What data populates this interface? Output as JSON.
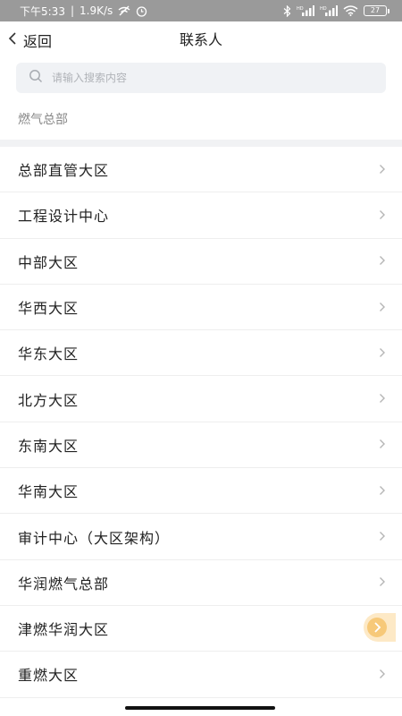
{
  "status_bar": {
    "time": "下午5:33",
    "speed": "1.9K/s",
    "battery": "27"
  },
  "nav": {
    "back_label": "返回",
    "title": "联系人"
  },
  "search": {
    "placeholder": "请输入搜索内容"
  },
  "breadcrumb": "燃气总部",
  "list": [
    "总部直管大区",
    "工程设计中心",
    "中部大区",
    "华西大区",
    "华东大区",
    "北方大区",
    "东南大区",
    "华南大区",
    "审计中心（大区架构）",
    "华润燃气总部",
    "津燃华润大区",
    "重燃大区"
  ],
  "colors": {
    "accent_float": "#f7c979",
    "search_bg": "#f0f2f5"
  }
}
